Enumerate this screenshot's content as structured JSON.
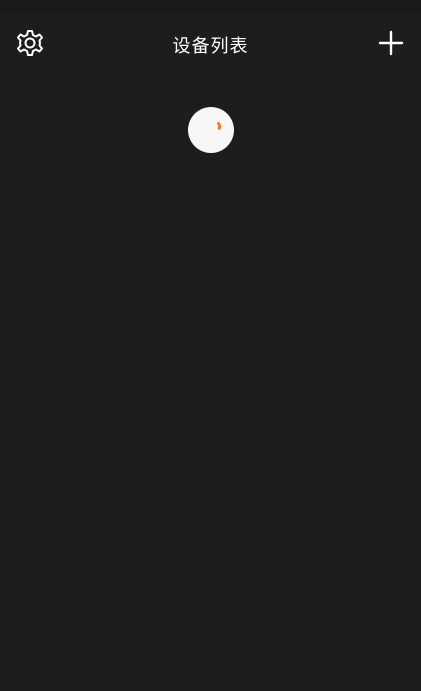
{
  "header": {
    "title": "设备列表",
    "settings_icon": "gear-icon",
    "add_icon": "plus-icon"
  },
  "content": {
    "loading_indicator": "refresh-spinner"
  },
  "colors": {
    "background": "#1d1d1d",
    "text": "#ffffff",
    "spinner_fill": "#f7f7f7",
    "spinner_accent": "#f07c2b"
  }
}
